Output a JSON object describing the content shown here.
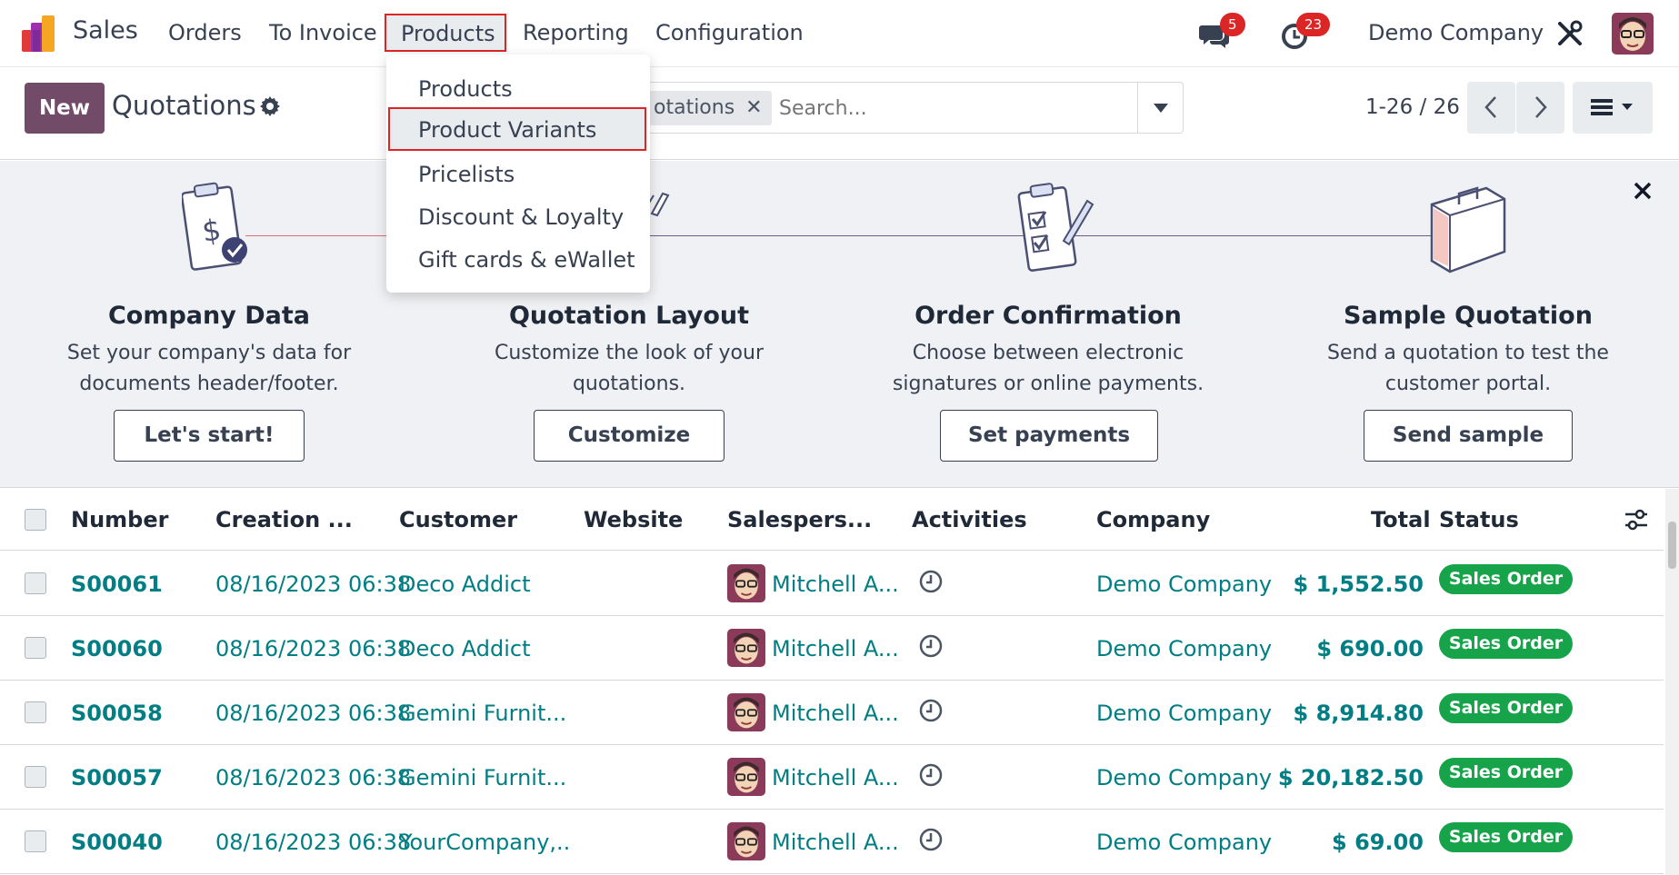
{
  "navbar": {
    "app_name": "Sales",
    "menu": [
      {
        "label": "Orders"
      },
      {
        "label": "To Invoice"
      },
      {
        "label": "Products"
      },
      {
        "label": "Reporting"
      },
      {
        "label": "Configuration"
      }
    ],
    "messages_count": "5",
    "activities_count": "23",
    "company": "Demo Company"
  },
  "products_menu": {
    "items": [
      "Products",
      "Product Variants",
      "Pricelists",
      "Discount & Loyalty",
      "Gift cards & eWallet"
    ],
    "highlighted": "Product Variants"
  },
  "control_panel": {
    "new_label": "New",
    "title": "Quotations",
    "facet_label": "otations",
    "search_placeholder": "Search...",
    "pager": "1-26 / 26"
  },
  "onboarding": {
    "steps": [
      {
        "title": "Company Data",
        "desc": "Set your company's data for documents header/footer.",
        "button": "Let's start!"
      },
      {
        "title": "Quotation Layout",
        "desc": "Customize the look of your quotations.",
        "button": "Customize"
      },
      {
        "title": "Order Confirmation",
        "desc": "Choose between electronic signatures or online payments.",
        "button": "Set payments"
      },
      {
        "title": "Sample Quotation",
        "desc": "Send a quotation to test the customer portal.",
        "button": "Send sample"
      }
    ]
  },
  "table": {
    "headers": {
      "number": "Number",
      "creation": "Creation ...",
      "customer": "Customer",
      "website": "Website",
      "salesperson": "Salespers...",
      "activities": "Activities",
      "company": "Company",
      "total": "Total",
      "status": "Status"
    },
    "rows": [
      {
        "number": "S00061",
        "date": "08/16/2023 06:38",
        "customer": "Deco Addict",
        "salesperson": "Mitchell A...",
        "company": "Demo Company",
        "total": "$ 1,552.50",
        "status": "Sales Order"
      },
      {
        "number": "S00060",
        "date": "08/16/2023 06:38",
        "customer": "Deco Addict",
        "salesperson": "Mitchell A...",
        "company": "Demo Company",
        "total": "$ 690.00",
        "status": "Sales Order"
      },
      {
        "number": "S00058",
        "date": "08/16/2023 06:38",
        "customer": "Gemini Furnit...",
        "salesperson": "Mitchell A...",
        "company": "Demo Company",
        "total": "$ 8,914.80",
        "status": "Sales Order"
      },
      {
        "number": "S00057",
        "date": "08/16/2023 06:38",
        "customer": "Gemini Furnit...",
        "salesperson": "Mitchell A...",
        "company": "Demo Company",
        "total": "$ 20,182.50",
        "status": "Sales Order"
      },
      {
        "number": "S00040",
        "date": "08/16/2023 06:38",
        "customer": "YourCompany,...",
        "salesperson": "Mitchell A...",
        "company": "Demo Company",
        "total": "$ 69.00",
        "status": "Sales Order"
      }
    ]
  },
  "colors": {
    "brand": "#714b67",
    "link": "#017e84",
    "status_green": "#16a34a",
    "badge_red": "#dc2626",
    "highlight_border": "#dc2626"
  }
}
